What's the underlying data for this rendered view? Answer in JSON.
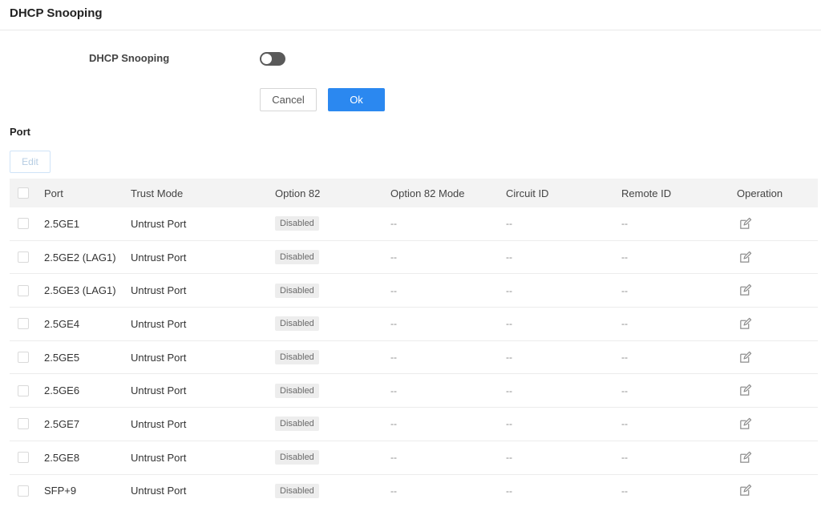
{
  "header": {
    "title": "DHCP Snooping"
  },
  "form": {
    "dhcp_snooping_label": "DHCP Snooping",
    "dhcp_snooping_enabled": false,
    "cancel_label": "Cancel",
    "ok_label": "Ok"
  },
  "port_section": {
    "title": "Port",
    "edit_label": "Edit"
  },
  "table": {
    "columns": {
      "port": "Port",
      "trust_mode": "Trust Mode",
      "option82": "Option 82",
      "option82_mode": "Option 82 Mode",
      "circuit_id": "Circuit ID",
      "remote_id": "Remote ID",
      "operation": "Operation"
    },
    "rows": [
      {
        "port": "2.5GE1",
        "trust_mode": "Untrust Port",
        "option82": "Disabled",
        "option82_mode": "--",
        "circuit_id": "--",
        "remote_id": "--"
      },
      {
        "port": "2.5GE2 (LAG1)",
        "trust_mode": "Untrust Port",
        "option82": "Disabled",
        "option82_mode": "--",
        "circuit_id": "--",
        "remote_id": "--"
      },
      {
        "port": "2.5GE3 (LAG1)",
        "trust_mode": "Untrust Port",
        "option82": "Disabled",
        "option82_mode": "--",
        "circuit_id": "--",
        "remote_id": "--"
      },
      {
        "port": "2.5GE4",
        "trust_mode": "Untrust Port",
        "option82": "Disabled",
        "option82_mode": "--",
        "circuit_id": "--",
        "remote_id": "--"
      },
      {
        "port": "2.5GE5",
        "trust_mode": "Untrust Port",
        "option82": "Disabled",
        "option82_mode": "--",
        "circuit_id": "--",
        "remote_id": "--"
      },
      {
        "port": "2.5GE6",
        "trust_mode": "Untrust Port",
        "option82": "Disabled",
        "option82_mode": "--",
        "circuit_id": "--",
        "remote_id": "--"
      },
      {
        "port": "2.5GE7",
        "trust_mode": "Untrust Port",
        "option82": "Disabled",
        "option82_mode": "--",
        "circuit_id": "--",
        "remote_id": "--"
      },
      {
        "port": "2.5GE8",
        "trust_mode": "Untrust Port",
        "option82": "Disabled",
        "option82_mode": "--",
        "circuit_id": "--",
        "remote_id": "--"
      },
      {
        "port": "SFP+9",
        "trust_mode": "Untrust Port",
        "option82": "Disabled",
        "option82_mode": "--",
        "circuit_id": "--",
        "remote_id": "--"
      }
    ]
  },
  "icons": {
    "row_operation": "edit-icon",
    "toggle": "toggle-switch"
  },
  "colors": {
    "primary": "#2b88f0",
    "toggle_off": "#5a5a5a",
    "header_bg": "#f3f3f3"
  }
}
